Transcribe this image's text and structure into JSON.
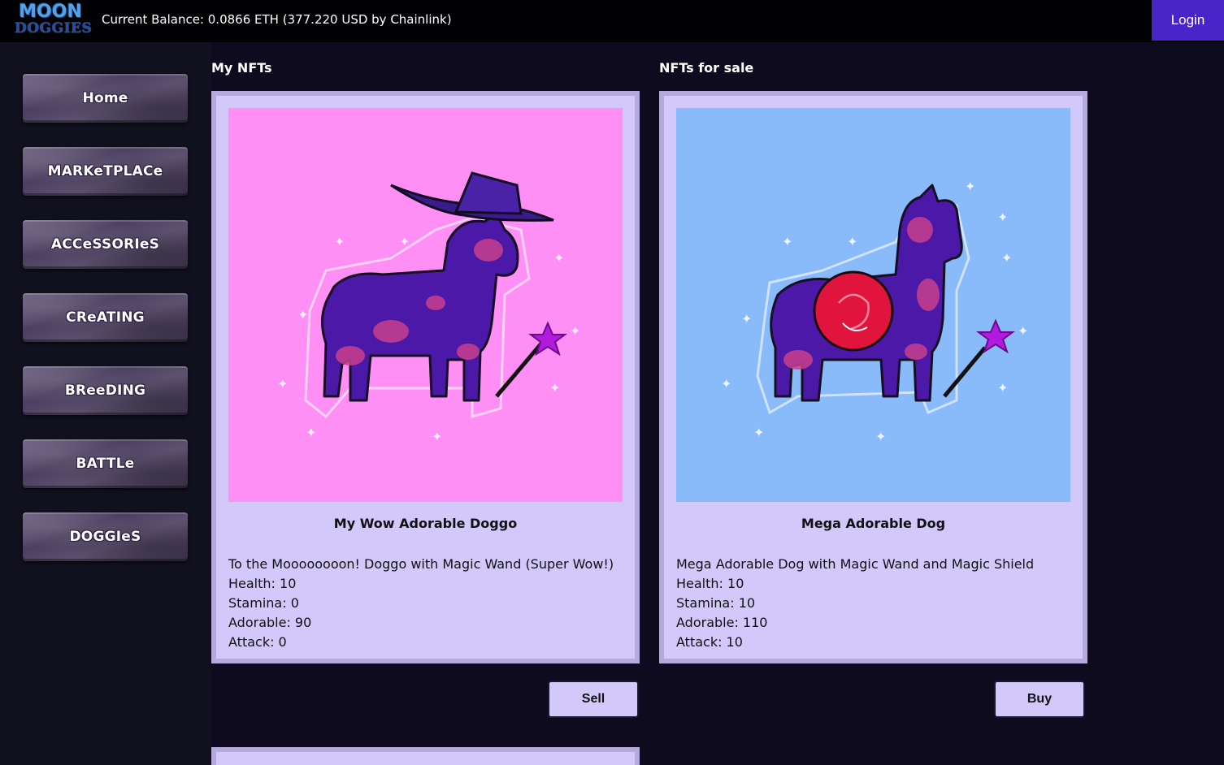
{
  "header": {
    "logo_line1": "MOON",
    "logo_line2": "DOGGIES",
    "balance": "Current Balance: 0.0866 ETH (377.220 USD by Chainlink)",
    "login_label": "Login",
    "login_color": "#4a24c9"
  },
  "sidebar": {
    "items": [
      {
        "label": "Home"
      },
      {
        "label": "MARKeTPLACe"
      },
      {
        "label": "ACCeSSORIeS"
      },
      {
        "label": "CReATING"
      },
      {
        "label": "BReeDING"
      },
      {
        "label": "BATTLe"
      },
      {
        "label": "DOGGIeS"
      }
    ]
  },
  "sections": {
    "my_nfts": "My NFTs",
    "for_sale": "NFTs for sale"
  },
  "my_nft": {
    "name": "My Wow Adorable Doggo",
    "description": "To the Moooooooon! Doggo with Magic Wand (Super Wow!)",
    "health": "Health: 10",
    "stamina": "Stamina: 0",
    "adorable": "Adorable: 90",
    "attack": "Attack: 0",
    "background_color": "#ff8ef5",
    "accessories": [
      "wizard-hat",
      "magic-wand"
    ],
    "action_label": "Sell"
  },
  "sale_nft": {
    "name": "Mega Adorable Dog",
    "description": "Mega Adorable Dog with Magic Wand and Magic Shield",
    "health": "Health: 10",
    "stamina": "Stamina: 10",
    "adorable": "Adorable: 110",
    "attack": "Attack: 10",
    "background_color": "#89baf9",
    "accessories": [
      "magic-shield",
      "magic-wand"
    ],
    "action_label": "Buy"
  }
}
